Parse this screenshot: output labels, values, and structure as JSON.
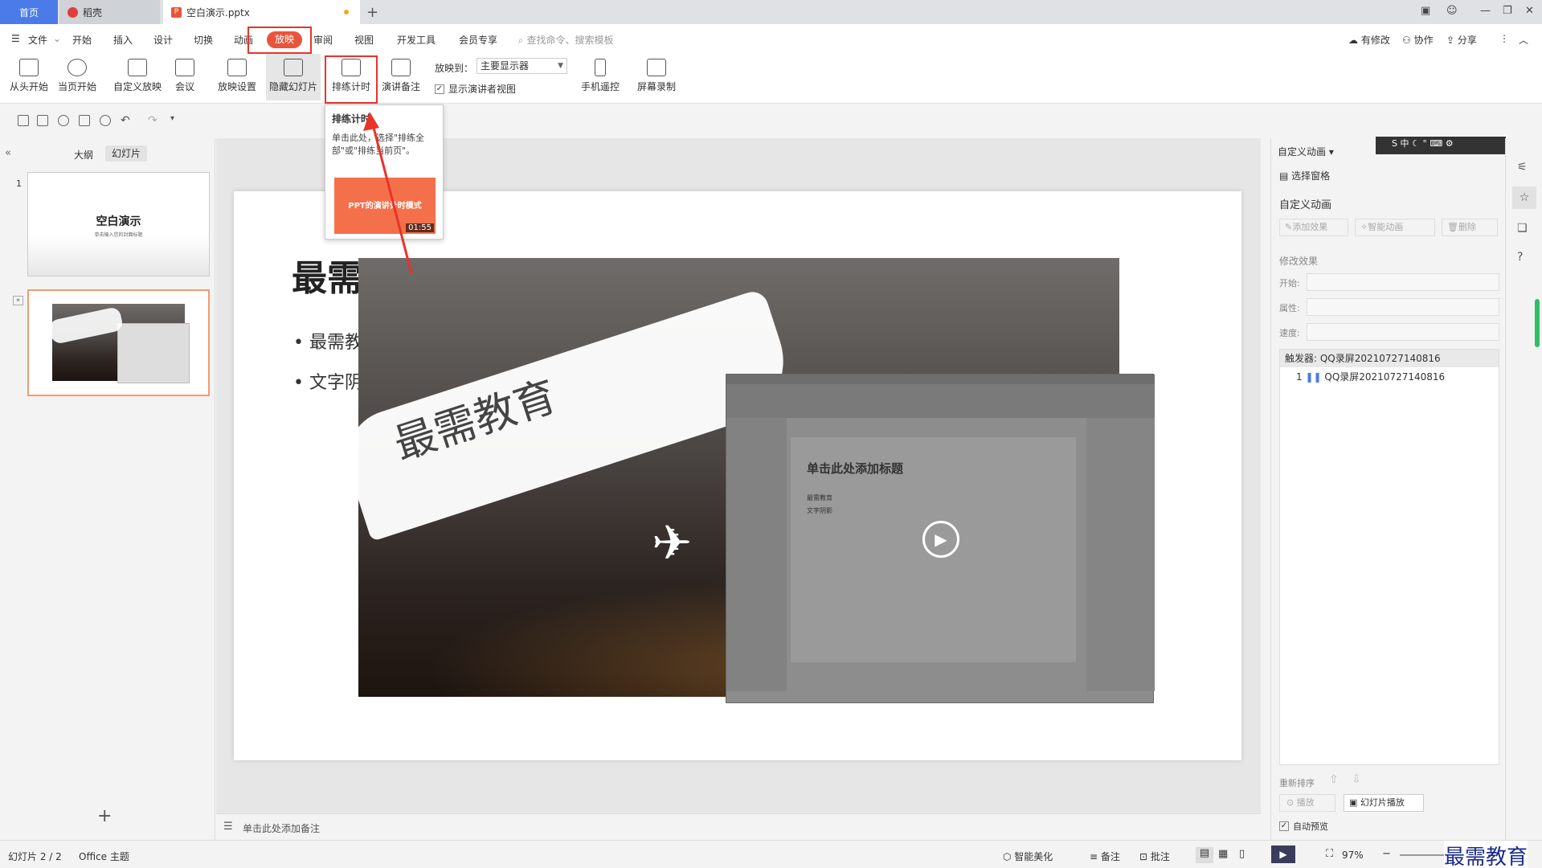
{
  "tabs": {
    "home": "首页",
    "daoke": "稻壳",
    "doc": "空白演示.pptx"
  },
  "menu": {
    "file": "文件",
    "start": "开始",
    "insert": "插入",
    "design": "设计",
    "transition": "切换",
    "animation": "动画",
    "slideshow": "放映",
    "review": "审阅",
    "view": "视图",
    "devtools": "开发工具",
    "member": "会员专享",
    "search": "查找命令、搜索模板",
    "modified": "有修改",
    "collab": "协作",
    "share": "分享"
  },
  "ribbon": {
    "from_start": "从头开始",
    "current": "当页开始",
    "custom": "自定义放映",
    "meeting": "会议",
    "settings": "放映设置",
    "hide": "隐藏幻灯片",
    "rehearse": "排练计时",
    "notes": "演讲备注",
    "play_to_label": "放映到：",
    "play_to_value": "主要显示器",
    "presenter_view": "显示演讲者视图",
    "remote": "手机遥控",
    "record": "屏幕录制"
  },
  "popup": {
    "title": "排练计时",
    "desc": "单击此处，选择\"排练全部\"或\"排练当前页\"。",
    "thumb_text": "PPT的演讲计时模式",
    "duration": "01:55"
  },
  "leftpanel": {
    "outline": "大纲",
    "slides": "幻灯片",
    "num1": "1",
    "num2": "2",
    "thumb1_title": "空白演示",
    "thumb1_sub": "单击输入您的封面标题"
  },
  "slide": {
    "title": "最需教育",
    "bullet1": "最需教育",
    "bullet2": "文字阴影",
    "brush_text": "最需教育",
    "inner_title": "单击此处添加标题",
    "inner_b1": "最需教育",
    "inner_b2": "文字阴影"
  },
  "notes": {
    "placeholder": "单击此处添加备注"
  },
  "rightpanel": {
    "header": "自定义动画",
    "select_pane": "选择窗格",
    "section": "自定义动画",
    "add_effect": "添加效果",
    "smart_anim": "智能动画",
    "delete": "删除",
    "modify": "修改效果",
    "start": "开始:",
    "property": "属性:",
    "speed": "速度:",
    "trigger": "触发器: QQ录屏20210727140816",
    "item_num": "1",
    "item_name": "QQ录屏20210727140816",
    "reorder": "重新排序",
    "play": "播放",
    "slideshow_play": "幻灯片播放",
    "autopreview": "自动预览"
  },
  "status": {
    "slide": "幻灯片 2 / 2",
    "theme": "Office 主题",
    "beautify": "智能美化",
    "notes": "备注",
    "comment": "批注",
    "zoom": "97%"
  },
  "watermark": "最需教育"
}
